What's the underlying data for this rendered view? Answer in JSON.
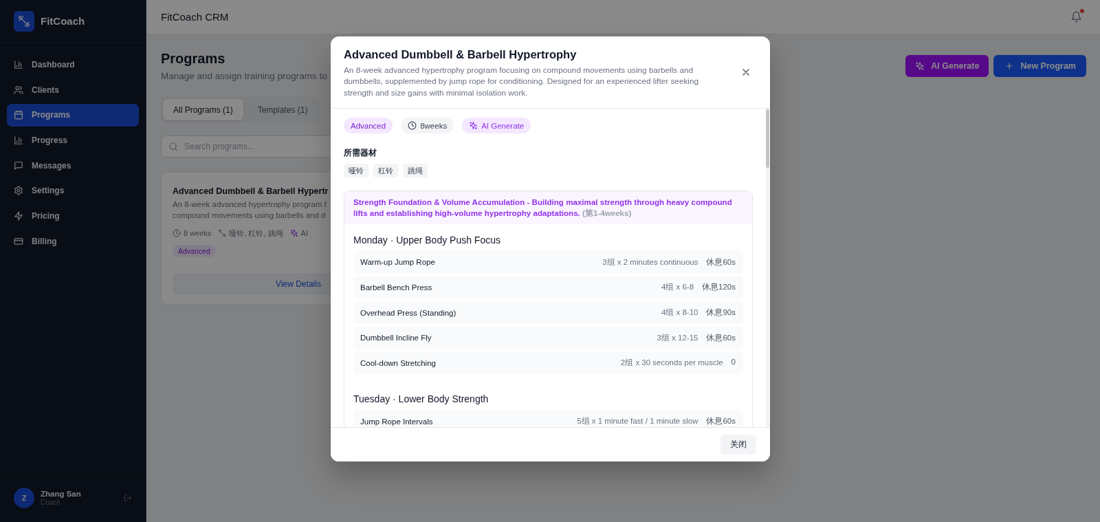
{
  "sidebar": {
    "brand": "FitCoach",
    "items": [
      {
        "label": "Dashboard",
        "kind": "dashboard",
        "selected": false
      },
      {
        "label": "Clients",
        "kind": "clients",
        "selected": false
      },
      {
        "label": "Programs",
        "kind": "programs",
        "selected": true
      },
      {
        "label": "Progress",
        "kind": "progress",
        "selected": false
      },
      {
        "label": "Messages",
        "kind": "messages",
        "selected": false
      },
      {
        "label": "Settings",
        "kind": "settings",
        "selected": false
      },
      {
        "label": "Pricing",
        "kind": "pricing",
        "selected": false
      },
      {
        "label": "Billing",
        "kind": "billing",
        "selected": false
      }
    ],
    "user": {
      "initial": "Z",
      "name": "Zhang San",
      "role": "Coach"
    }
  },
  "topbar": {
    "title": "FitCoach CRM",
    "unread": true
  },
  "page": {
    "title": "Programs",
    "subtitle": "Manage and assign training programs to",
    "actions": [
      {
        "label": "AI Generate",
        "kind": "ai"
      },
      {
        "label": "New Program",
        "kind": "add"
      }
    ],
    "tabs": [
      {
        "label": "All Programs (1)",
        "selected": true
      },
      {
        "label": "Templates (1)",
        "selected": false
      }
    ],
    "search": {
      "placeholder": "Search programs..."
    },
    "cards": [
      {
        "title": "Advanced Dumbbell & Barbell Hypertr",
        "description_lines": [
          "An 8-week advanced hypertrophy program f",
          "compound movements using barbells and d"
        ],
        "meta": [
          {
            "kind": "duration",
            "text": "8 weeks"
          },
          {
            "kind": "equipment",
            "text": "哑铃, 杠铃, 跳绳"
          },
          {
            "kind": "ai",
            "text": "AI"
          }
        ],
        "badge": "Advanced",
        "action": "View Details"
      }
    ]
  },
  "modal": {
    "title": "Advanced Dumbbell & Barbell Hypertrophy",
    "description": "An 8-week advanced hypertrophy program focusing on compound movements using barbells and dumbbells, supplemented by jump rope for conditioning. Designed for an experienced lifter seeking strength and size gains with minimal isolation work.",
    "tags": [
      {
        "kind": "level",
        "text": "Advanced"
      },
      {
        "kind": "duration",
        "text": "8weeks"
      },
      {
        "kind": "ai",
        "text": "AI Generate"
      }
    ],
    "equipment_heading": "所需器材",
    "equipment": [
      "哑铃",
      "杠铃",
      "跳绳"
    ],
    "phases": [
      {
        "description": "Strength Foundation & Volume Accumulation - Building maximal strength through heavy compound lifts and establishing high-volume hypertrophy adaptations.",
        "weeks": "(第1-4weeks)",
        "days": [
          {
            "title": "Monday · Upper Body Push Focus",
            "exercises": [
              {
                "name": "Warm-up Jump Rope",
                "sets": "3组 x 2 minutes continuous",
                "rest": "休息60s"
              },
              {
                "name": "Barbell Bench Press",
                "sets": "4组 x 6-8",
                "rest": "休息120s"
              },
              {
                "name": "Overhead Press (Standing)",
                "sets": "4组 x 8-10",
                "rest": "休息90s"
              },
              {
                "name": "Dumbbell Incline Fly",
                "sets": "3组 x 12-15",
                "rest": "休息60s"
              },
              {
                "name": "Cool-down Stretching",
                "sets": "2组 x 30 seconds per muscle",
                "rest": "0"
              }
            ]
          },
          {
            "title": "Tuesday · Lower Body Strength",
            "exercises": [
              {
                "name": "Jump Rope Intervals",
                "sets": "5组 x 1 minute fast / 1 minute slow",
                "rest": "休息60s"
              }
            ]
          }
        ]
      }
    ],
    "close_label": "关闭"
  }
}
